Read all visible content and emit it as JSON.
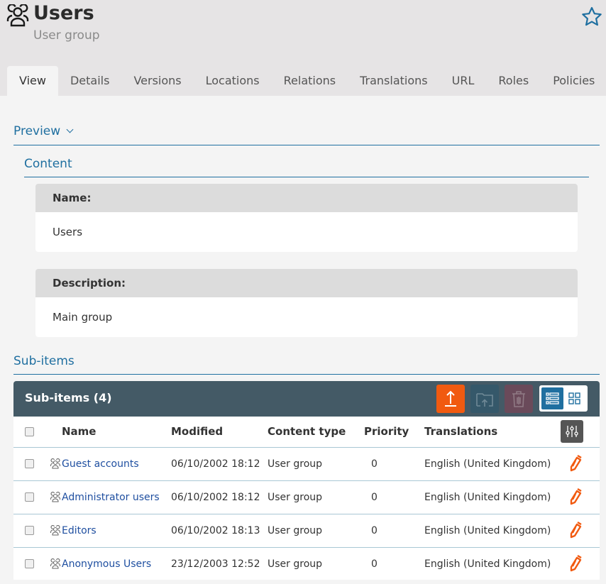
{
  "header": {
    "title": "Users",
    "subtitle": "User group",
    "icon": "user-group-icon",
    "bookmark_icon": "star-icon"
  },
  "tabs": [
    {
      "label": "View",
      "active": true
    },
    {
      "label": "Details"
    },
    {
      "label": "Versions"
    },
    {
      "label": "Locations"
    },
    {
      "label": "Relations"
    },
    {
      "label": "Translations"
    },
    {
      "label": "URL"
    },
    {
      "label": "Roles"
    },
    {
      "label": "Policies"
    }
  ],
  "preview": {
    "label": "Preview",
    "content_label": "Content",
    "fields": [
      {
        "label": "Name:",
        "value": "Users"
      },
      {
        "label": "Description:",
        "value": "Main group"
      }
    ]
  },
  "subitems": {
    "section_label": "Sub-items",
    "panel_title": "Sub-items (4)",
    "toolbar": {
      "upload_icon": "upload-icon",
      "move_icon": "folder-upload-icon",
      "delete_icon": "trash-icon",
      "list_view_icon": "list-view-icon",
      "grid_view_icon": "grid-view-icon"
    },
    "colors": {
      "accent": "#f15a10",
      "header_bg": "#445a66",
      "link": "#1f4fa0",
      "rule": "#1f6fa0"
    },
    "columns": [
      "Name",
      "Modified",
      "Content type",
      "Priority",
      "Translations"
    ],
    "rows": [
      {
        "name": "Guest accounts",
        "modified": "06/10/2002 18:12",
        "type": "User group",
        "priority": "0",
        "translations": "English (United Kingdom)"
      },
      {
        "name": "Administrator users",
        "modified": "06/10/2002 18:12",
        "type": "User group",
        "priority": "0",
        "translations": "English (United Kingdom)"
      },
      {
        "name": "Editors",
        "modified": "06/10/2002 18:13",
        "type": "User group",
        "priority": "0",
        "translations": "English (United Kingdom)"
      },
      {
        "name": "Anonymous Users",
        "modified": "23/12/2003 12:52",
        "type": "User group",
        "priority": "0",
        "translations": "English (United Kingdom)"
      }
    ]
  }
}
